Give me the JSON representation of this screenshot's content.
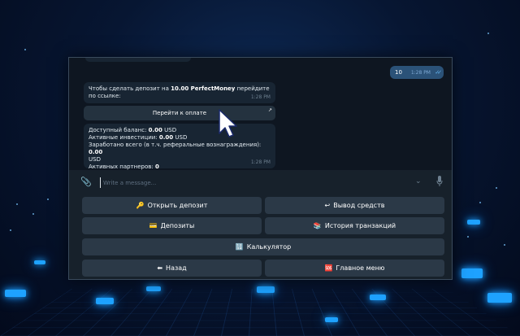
{
  "chat": {
    "outgoing": {
      "text": "10",
      "time": "1:28 PM"
    },
    "message1": {
      "text_before": "Чтобы сделать депозит на ",
      "amount": "10.00 PerfectMoney",
      "text_after": " перейдите по ссылке:",
      "time": "1:28 PM"
    },
    "inline_button": {
      "label": "Перейти к оплате"
    },
    "message2": {
      "balance_label": "Доступный баланс: ",
      "balance_value": "0.00",
      "balance_unit": " USD",
      "investments_label": "Активные инвестиции: ",
      "investments_value": "0.00",
      "investments_unit": " USD",
      "earned_label": "Заработано всего (в т.ч. реферальные вознаграждения): ",
      "earned_value": "0.00",
      "earned_unit": "USD",
      "partners_label": "Активных партнеров: ",
      "partners_value": "0",
      "time": "1:28 PM"
    }
  },
  "composer": {
    "placeholder": "Write a message..."
  },
  "keyboard": {
    "open_deposit": {
      "icon": "🔑",
      "label": "Открыть депозит"
    },
    "withdraw": {
      "icon": "↩",
      "label": "Вывод средств"
    },
    "deposits": {
      "icon": "💳",
      "label": "Депозиты"
    },
    "history": {
      "icon": "📚",
      "label": "История транзакций"
    },
    "calculator": {
      "icon": "🔢",
      "label": "Калькулятор"
    },
    "back": {
      "icon": "⬅",
      "label": "Назад"
    },
    "main_menu": {
      "icon": "🆘",
      "label": "Главное меню"
    }
  },
  "colors": {
    "chat_bg": "#0e1621",
    "panel_bg": "#17212b",
    "bubble_in": "#182533",
    "bubble_out": "#2b5278",
    "keyboard_button": "#2b3947",
    "accent": "#64b5ef"
  }
}
